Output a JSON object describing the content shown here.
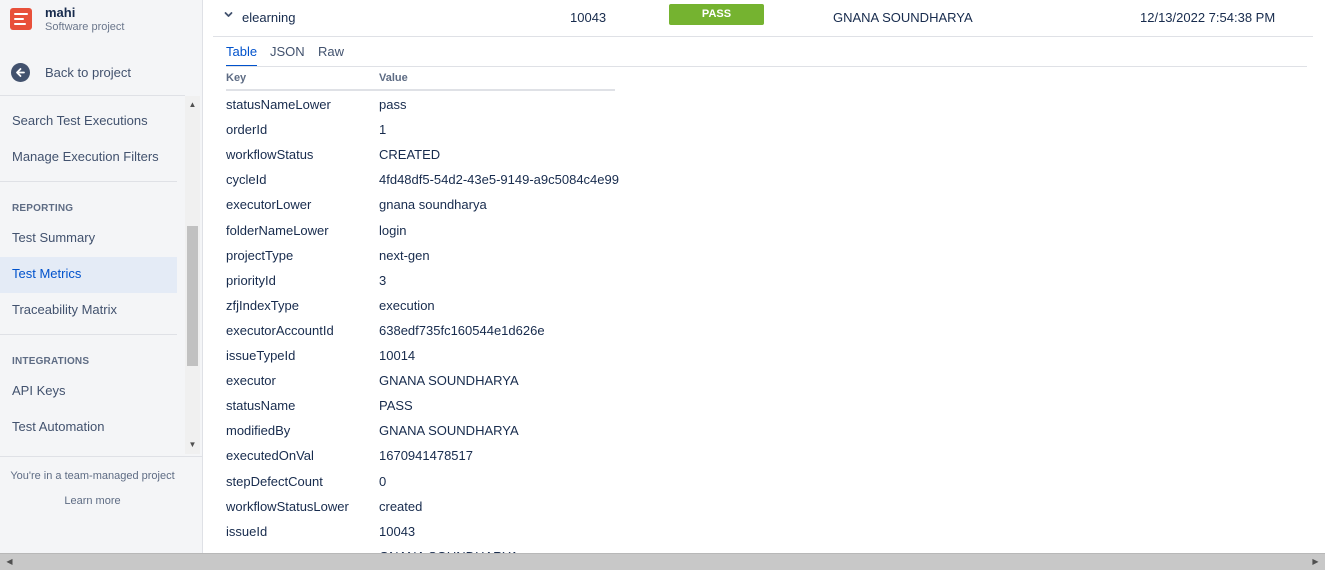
{
  "sidebar": {
    "project_name": "mahi",
    "project_type": "Software project",
    "back_label": "Back to project",
    "items_top": [
      {
        "label": "Search Test Executions"
      },
      {
        "label": "Manage Execution Filters"
      }
    ],
    "reporting_heading": "REPORTING",
    "reporting_items": [
      {
        "label": "Test Summary"
      },
      {
        "label": "Test Metrics",
        "active": true
      },
      {
        "label": "Traceability Matrix"
      }
    ],
    "integrations_heading": "INTEGRATIONS",
    "integrations_items": [
      {
        "label": "API Keys"
      },
      {
        "label": "Test Automation"
      }
    ],
    "footer_note": "You're in a team-managed project",
    "footer_link": "Learn more"
  },
  "execution": {
    "name": "elearning",
    "id": "10043",
    "status": "PASS",
    "status_color": "#75b330",
    "user": "GNANA SOUNDHARYA",
    "date": "12/13/2022 7:54:38 PM"
  },
  "tabs": [
    {
      "label": "Table",
      "active": true
    },
    {
      "label": "JSON"
    },
    {
      "label": "Raw"
    }
  ],
  "kv_table": {
    "key_header": "Key",
    "value_header": "Value",
    "rows": [
      {
        "key": "statusNameLower",
        "value": "pass"
      },
      {
        "key": "orderId",
        "value": "1"
      },
      {
        "key": "workflowStatus",
        "value": "CREATED"
      },
      {
        "key": "cycleId",
        "value": "4fd48df5-54d2-43e5-9149-a9c5084c4e99"
      },
      {
        "key": "executorLower",
        "value": "gnana soundharya"
      },
      {
        "key": "folderNameLower",
        "value": "login"
      },
      {
        "key": "projectType",
        "value": "next-gen"
      },
      {
        "key": "priorityId",
        "value": "3"
      },
      {
        "key": "zfjIndexType",
        "value": "execution"
      },
      {
        "key": "executorAccountId",
        "value": "638edf735fc160544e1d626e"
      },
      {
        "key": "issueTypeId",
        "value": "10014"
      },
      {
        "key": "executor",
        "value": "GNANA SOUNDHARYA"
      },
      {
        "key": "statusName",
        "value": "PASS"
      },
      {
        "key": "modifiedBy",
        "value": "GNANA SOUNDHARYA"
      },
      {
        "key": "executedOnVal",
        "value": "1670941478517"
      },
      {
        "key": "stepDefectCount",
        "value": "0"
      },
      {
        "key": "workflowStatusLower",
        "value": "created"
      },
      {
        "key": "issueId",
        "value": "10043"
      },
      {
        "key": "",
        "value": "GNANA SOUNDHARYA"
      }
    ]
  }
}
